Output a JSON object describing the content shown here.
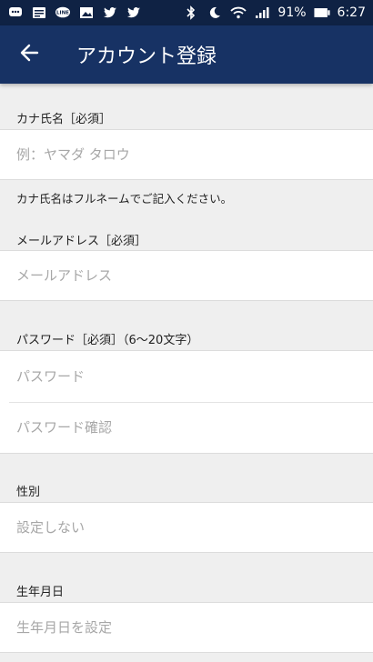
{
  "status": {
    "battery_percent": "91%",
    "time": "6:27"
  },
  "header": {
    "title": "アカウント登録"
  },
  "form": {
    "kana_label": "カナ氏名［必須］",
    "kana_placeholder": "例：ヤマダ タロウ",
    "kana_note": "カナ氏名はフルネームでご記入ください。",
    "email_label": "メールアドレス［必須］",
    "email_placeholder": "メールアドレス",
    "password_label": "パスワード［必須］（6〜20文字）",
    "password_placeholder": "パスワード",
    "password_confirm_placeholder": "パスワード確認",
    "gender_label": "性別",
    "gender_value": "設定しない",
    "birthday_label": "生年月日",
    "birthday_placeholder": "生年月日を設定"
  },
  "colors": {
    "status_bar": "#0f2244",
    "app_bar": "#173264",
    "background": "#efefef"
  }
}
